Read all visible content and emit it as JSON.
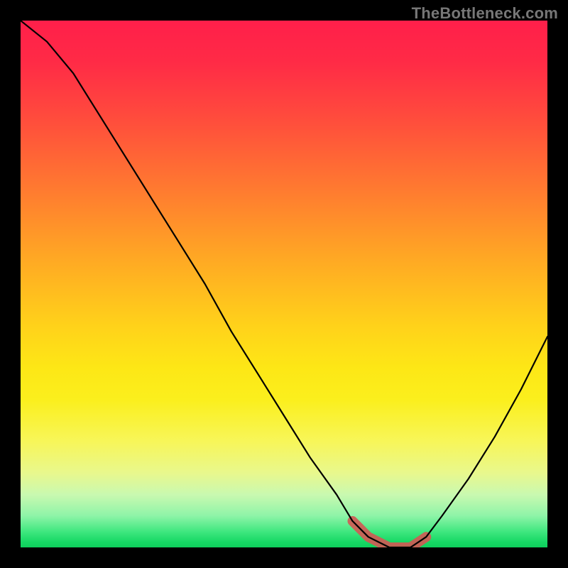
{
  "watermark": "TheBottleneck.com",
  "colors": {
    "background": "#000000",
    "curve": "#000000",
    "highlight": "#cf5a55",
    "gradient_top": "#ff1f4a",
    "gradient_bottom": "#0fcf5c"
  },
  "chart_data": {
    "type": "line",
    "title": "",
    "xlabel": "",
    "ylabel": "",
    "xlim": [
      0,
      100
    ],
    "ylim": [
      0,
      100
    ],
    "grid": false,
    "legend": false,
    "series": [
      {
        "name": "curve",
        "x": [
          0,
          5,
          10,
          15,
          20,
          25,
          30,
          35,
          40,
          45,
          50,
          55,
          60,
          63,
          66,
          70,
          74,
          77,
          80,
          85,
          90,
          95,
          100
        ],
        "values": [
          100,
          96,
          90,
          82,
          74,
          66,
          58,
          50,
          41,
          33,
          25,
          17,
          10,
          5,
          2,
          0,
          0,
          2,
          6,
          13,
          21,
          30,
          40
        ]
      },
      {
        "name": "valley-highlight",
        "x": [
          63,
          66,
          70,
          74,
          77
        ],
        "values": [
          5,
          2,
          0,
          0,
          2
        ]
      }
    ]
  }
}
